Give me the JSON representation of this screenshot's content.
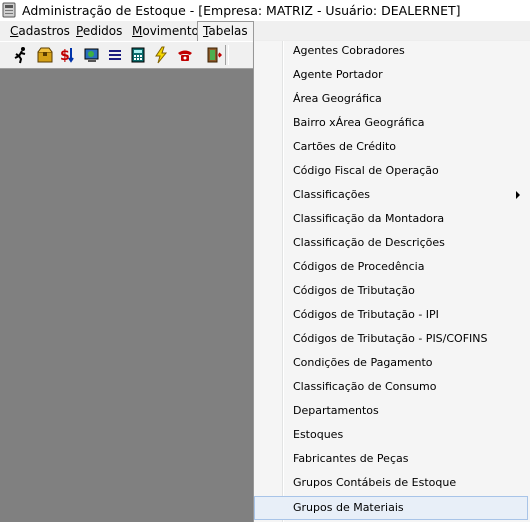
{
  "window": {
    "title": "Administração de Estoque - [Empresa: MATRIZ - Usuário: DEALERNET]",
    "icon": "app-window-icon"
  },
  "menubar": {
    "items": [
      {
        "label_ul": "C",
        "label_rest": "adastros"
      },
      {
        "label_ul": "P",
        "label_rest": "edidos"
      },
      {
        "label_ul": "M",
        "label_rest": "ovimento"
      },
      {
        "label_ul": "T",
        "label_rest": "abelas"
      }
    ],
    "active_index": 3
  },
  "toolbar": {
    "buttons": [
      "running-man-icon",
      "box-icon",
      "dollar-arrows-icon",
      "monitor-globe-icon",
      "list-lines-icon",
      "calculator-icon",
      "lightning-icon",
      "telephone-icon",
      "exit-door-icon"
    ]
  },
  "dropdown": {
    "items": [
      {
        "label": "Agentes Cobradores"
      },
      {
        "label": "Agente Portador"
      },
      {
        "label": "Área Geográfica"
      },
      {
        "label": "Bairro xÁrea Geográfica"
      },
      {
        "label": "Cartões de Crédito"
      },
      {
        "label": "Código Fiscal de Operação"
      },
      {
        "label": "Classificações",
        "submenu": true
      },
      {
        "label": "Classificação da Montadora"
      },
      {
        "label": "Classificação de Descrições"
      },
      {
        "label": "Códigos de Procedência"
      },
      {
        "label": "Códigos de Tributação"
      },
      {
        "label": "Códigos de Tributação - IPI"
      },
      {
        "label": "Códigos de Tributação - PIS/COFINS"
      },
      {
        "label": "Condições de Pagamento"
      },
      {
        "label": "Classificação de Consumo"
      },
      {
        "label": "Departamentos"
      },
      {
        "label": "Estoques"
      },
      {
        "label": "Fabricantes de  Peças"
      },
      {
        "label": "Grupos Contábeis de Estoque"
      },
      {
        "label": "Grupos de Materiais",
        "highlighted": true
      }
    ]
  },
  "colors": {
    "workspace": "#808080",
    "menu_background": "#f5f5f5",
    "highlight": "#e8eff8",
    "highlight_border": "#a8c4e8"
  }
}
